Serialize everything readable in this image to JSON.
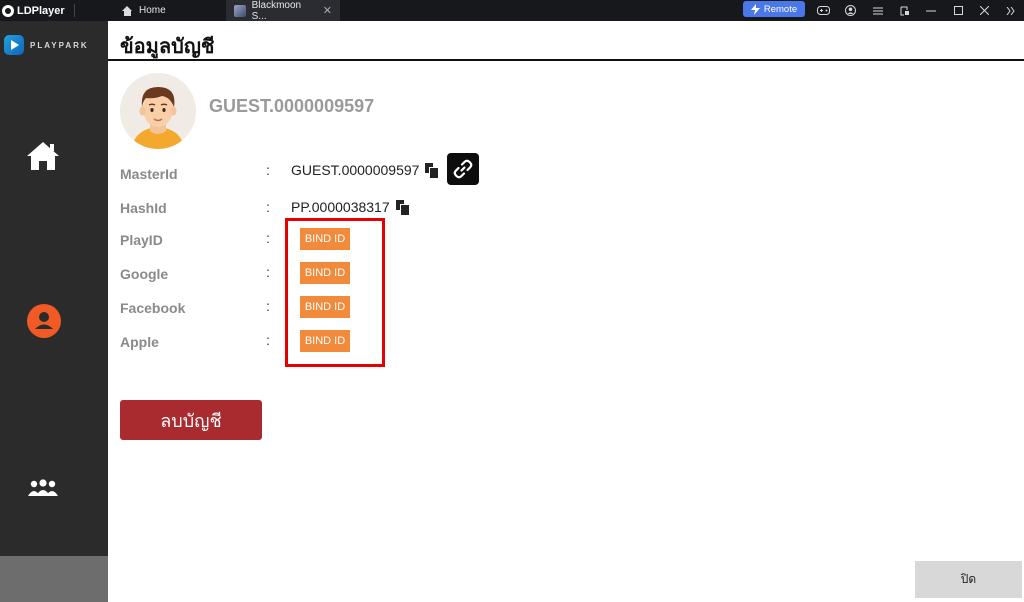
{
  "titlebar": {
    "app_name": "LDPlayer",
    "tabs": [
      {
        "label": "Home"
      },
      {
        "label": "Blackmoon S...",
        "close": "✕"
      }
    ],
    "remote_label": "Remote"
  },
  "sidebar": {
    "brand": "PLAYPARK"
  },
  "page": {
    "title": "ข้อมูลบัญชี"
  },
  "profile": {
    "name": "GUEST.0000009597"
  },
  "fields": [
    {
      "label": "MasterId",
      "colon": ":",
      "value": "GUEST.0000009597"
    },
    {
      "label": "HashId",
      "colon": ":",
      "value": "PP.0000038317"
    },
    {
      "label": "PlayID",
      "colon": ":",
      "button": "BIND ID"
    },
    {
      "label": "Google",
      "colon": ":",
      "button": "BIND ID"
    },
    {
      "label": "Facebook",
      "colon": ":",
      "button": "BIND ID"
    },
    {
      "label": "Apple",
      "colon": ":",
      "button": "BIND ID"
    }
  ],
  "actions": {
    "delete_account": "ลบบัญชี",
    "close": "ปิด"
  },
  "colors": {
    "bind_button": "#f28a3c",
    "delete_button": "#a92a2f",
    "highlight": "#e60000",
    "sidebar": "#2b2b2b",
    "profile_active": "#f15a24"
  },
  "icons": [
    "home-icon",
    "profile-icon",
    "group-icon",
    "copy-icon",
    "link-icon",
    "gamepad-icon",
    "account-icon",
    "menu-icon",
    "minimize-icon",
    "maximize-icon",
    "close-icon"
  ]
}
